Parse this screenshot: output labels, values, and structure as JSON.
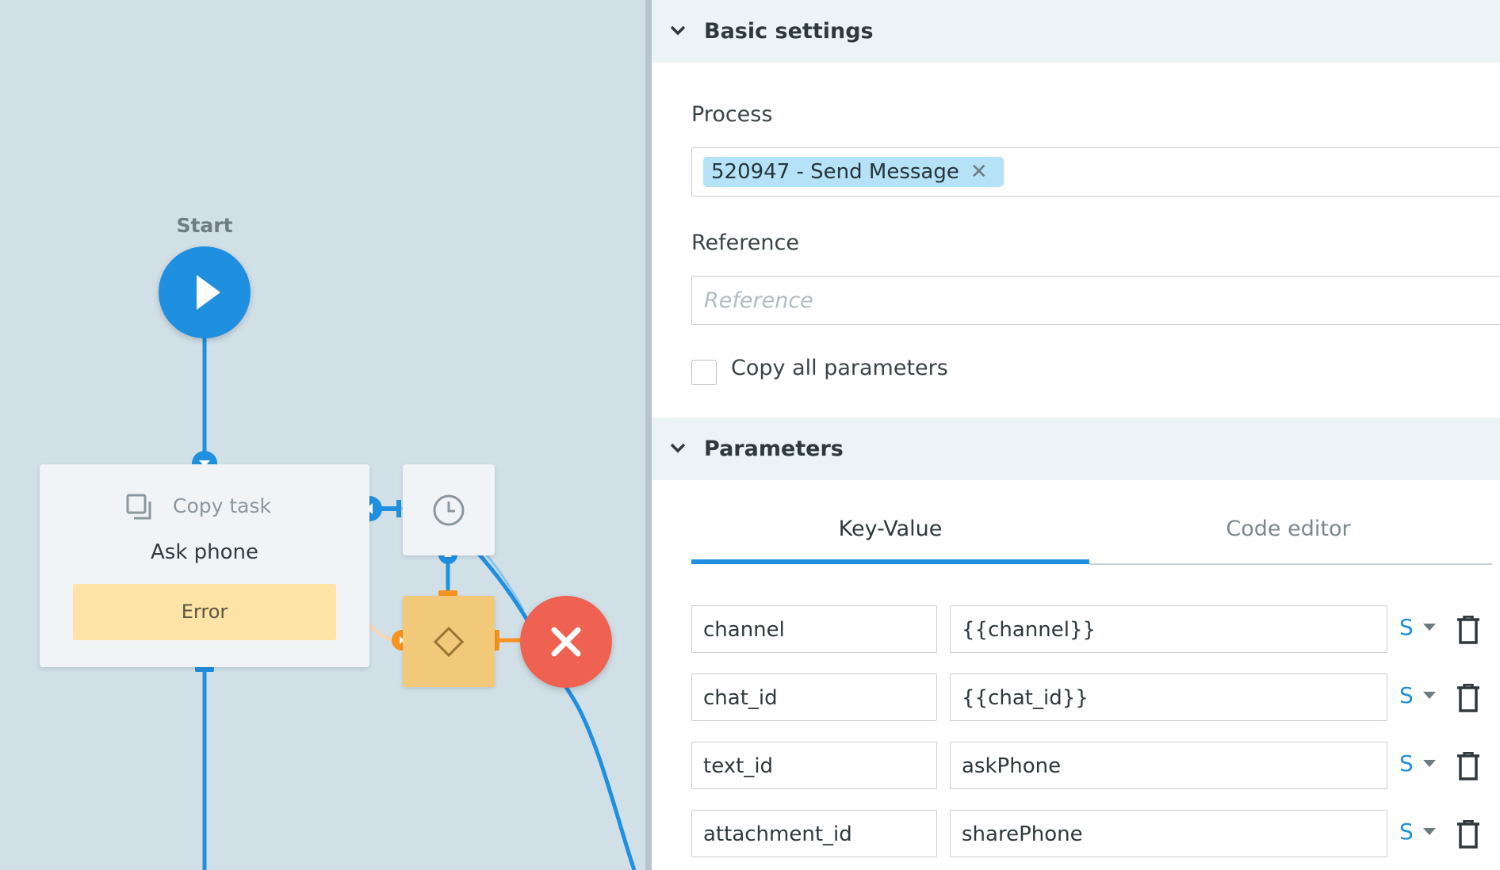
{
  "canvas": {
    "start_label": "Start",
    "task": {
      "type_label": "Copy task",
      "name": "Ask phone",
      "error_label": "Error"
    }
  },
  "panel": {
    "basic_settings": {
      "title": "Basic settings",
      "process_label": "Process",
      "process_chip": "520947 - Send Message",
      "reference_label": "Reference",
      "reference_placeholder": "Reference",
      "reference_value": "",
      "copy_all_label": "Copy all parameters",
      "copy_all_checked": false
    },
    "parameters": {
      "title": "Parameters",
      "tabs": [
        {
          "label": "Key-Value",
          "active": true
        },
        {
          "label": "Code editor",
          "active": false
        }
      ],
      "rows": [
        {
          "key": "channel",
          "value": "{{channel}}",
          "type": "S"
        },
        {
          "key": "chat_id",
          "value": "{{chat_id}}",
          "type": "S"
        },
        {
          "key": "text_id",
          "value": "askPhone",
          "type": "S"
        },
        {
          "key": "attachment_id",
          "value": "sharePhone",
          "type": "S"
        }
      ]
    }
  },
  "colors": {
    "accent": "#1f8fdf",
    "canvas_bg": "#d1dfe7",
    "error_slot": "#fde3a6",
    "condition_node": "#f1c978",
    "end_node": "#ef6150",
    "chip_bg": "#b6e2f7"
  },
  "icons": {
    "start": "play-icon",
    "task": "copy-icon",
    "timer": "clock-icon",
    "condition": "diamond-icon",
    "end": "close-icon",
    "section_toggle": "chevron-down-icon",
    "chip_remove": "close-icon",
    "row_delete": "trash-icon"
  }
}
